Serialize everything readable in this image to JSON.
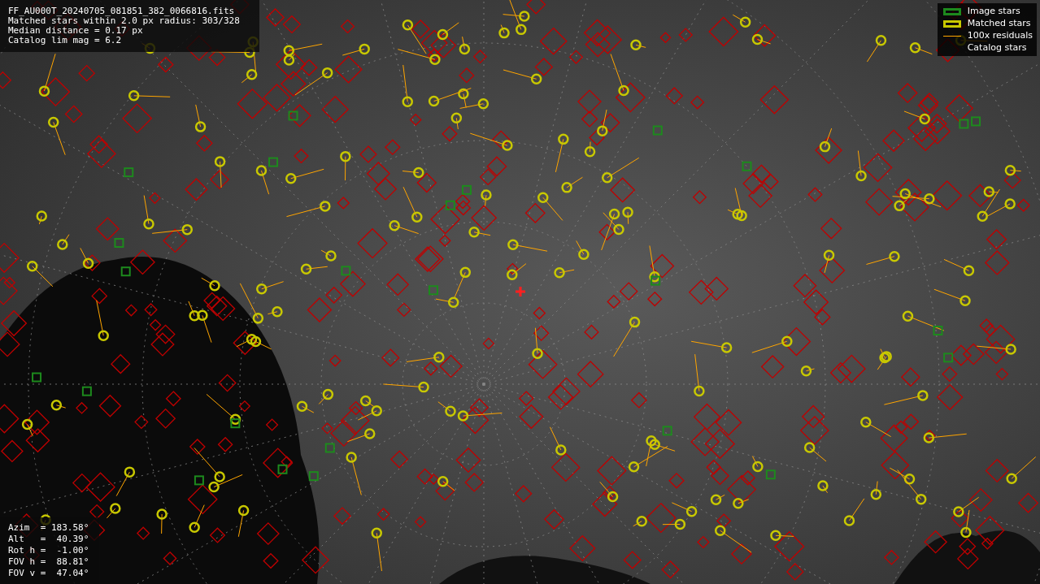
{
  "info": {
    "lines": [
      "FF_AU000T_20240705_081851_382_0066816.fits",
      "Matched stars within 2.0 px radius: 303/328",
      "Median distance = 0.17 px",
      "Catalog lim mag = 6.2"
    ]
  },
  "legend": {
    "items": [
      {
        "kind": "box",
        "color": "#1d8a1d",
        "label": "Image stars"
      },
      {
        "kind": "box",
        "color": "#c8c800",
        "label": "Matched stars"
      },
      {
        "kind": "line",
        "color": "#ffa500",
        "label": "100x residuals"
      },
      {
        "kind": "none",
        "label": "Catalog stars"
      }
    ]
  },
  "pointing": {
    "lines": [
      "Azim  = 183.58°",
      "Alt   =  40.39°",
      "Rot h =  -1.00°",
      "FOV h =  88.81°",
      "FOV v =  47.04°"
    ]
  }
}
